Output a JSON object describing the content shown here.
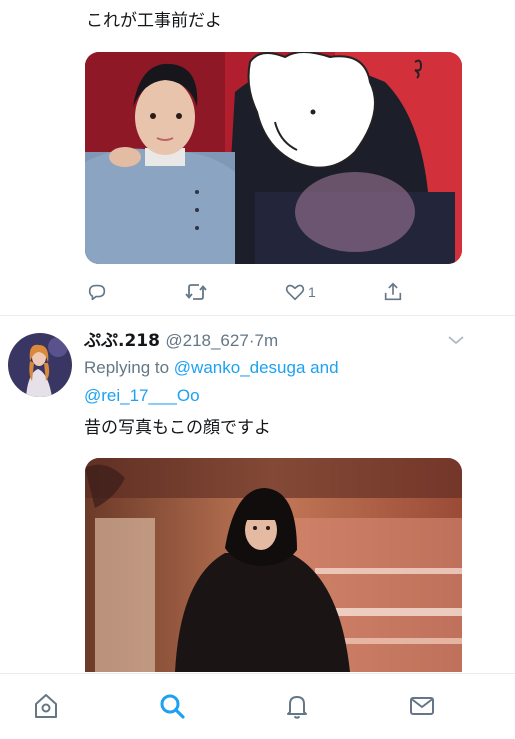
{
  "tweet1": {
    "text": "これが工事前だよ",
    "reply_count": "",
    "retweet_count": "",
    "like_count": "1"
  },
  "tweet2": {
    "display_name": "ぷぷ.218",
    "handle": "@218_627",
    "separator": "·",
    "time": "7m",
    "replying_prefix": "Replying to",
    "mention_1": "@wanko_desuga",
    "conjunction": "and",
    "mention_2": "@rei_17___Oo",
    "text": "昔の写真もこの顔ですよ"
  },
  "icons": {
    "reply": "reply-icon",
    "retweet": "retweet-icon",
    "like": "heart-icon",
    "share": "share-icon",
    "caret": "chevron-down-icon",
    "home": "home-icon",
    "search": "search-icon",
    "notifications": "bell-icon",
    "messages": "mail-icon"
  },
  "colors": {
    "accent": "#1da1f2",
    "secondary_text": "#657786",
    "divider": "#e6ecf0"
  },
  "tabbar": {
    "active_tab": "search"
  }
}
